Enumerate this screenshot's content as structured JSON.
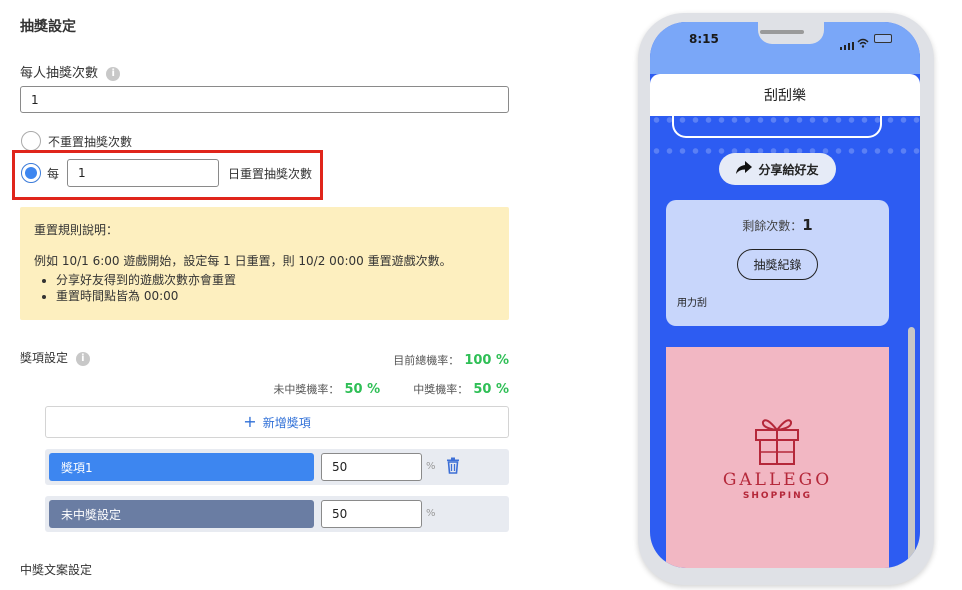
{
  "page": {
    "title": "抽獎設定",
    "per_person": {
      "label": "每人抽獎次數",
      "value": "1"
    },
    "reset": {
      "option_no_reset": "不重置抽獎次數",
      "option_every_prefix": "每",
      "every_value": "1",
      "option_every_suffix": "日重置抽獎次數"
    },
    "note": {
      "title": "重置規則說明：",
      "example": "例如 10/1 6:00 遊戲開始，設定每 1 日重置，則 10/2 00:00 重置遊戲次數。",
      "bullets": [
        "分享好友得到的遊戲次數亦會重置",
        "重置時間點皆為 00:00"
      ]
    },
    "prizes": {
      "label": "獎項設定",
      "total_rate_label": "目前總機率：",
      "total_rate_value": "100 %",
      "lose_rate_label": "未中獎機率：",
      "lose_rate_value": "50 %",
      "win_rate_label": "中獎機率：",
      "win_rate_value": "50 %",
      "add_label": "新增獎項",
      "items": [
        {
          "name": "獎項1",
          "value": "50",
          "unit": "%",
          "color": "#3d86f0"
        },
        {
          "name": "未中獎設定",
          "value": "50",
          "unit": "%",
          "color": "#6a7da3"
        }
      ]
    },
    "win_text_label": "中獎文案設定"
  },
  "phone": {
    "time": "8:15",
    "title": "刮刮樂",
    "share_label": "分享給好友",
    "remaining_label": "剩餘次數：",
    "remaining_value": "1",
    "records_label": "抽獎紀錄",
    "hint": "用力刮",
    "brand": "GALLEGO",
    "brand_sub": "SHOPPING"
  },
  "colors": {
    "accent": "#3d86f0",
    "highlight_border": "#e0251b",
    "green": "#2fbf56",
    "note_bg": "#fdefbf",
    "phone_bg": "#2d5cf2",
    "brand": "#b5283a"
  }
}
